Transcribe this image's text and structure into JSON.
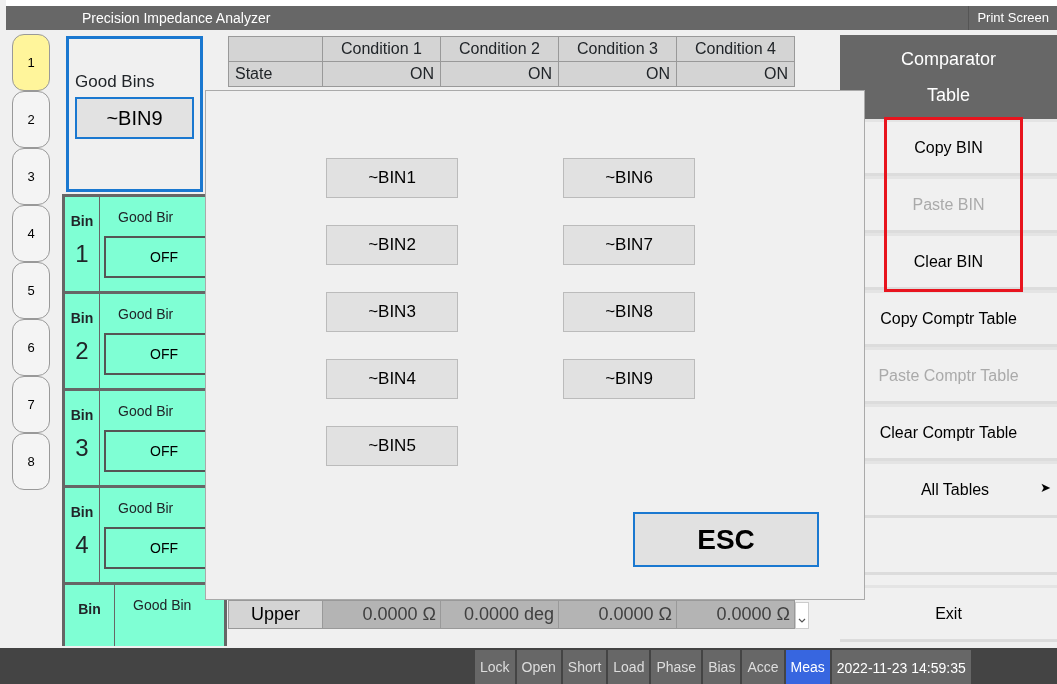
{
  "window": {
    "title": "Precision Impedance Analyzer",
    "print_button": "Print Screen"
  },
  "side_tabs": [
    {
      "label": "1",
      "selected": true
    },
    {
      "label": "2",
      "selected": false
    },
    {
      "label": "3",
      "selected": false
    },
    {
      "label": "4",
      "selected": false
    },
    {
      "label": "5",
      "selected": false
    },
    {
      "label": "6",
      "selected": false
    },
    {
      "label": "7",
      "selected": false
    },
    {
      "label": "8",
      "selected": false
    }
  ],
  "good_bins": {
    "label": "Good Bins",
    "value": "~BIN9"
  },
  "conditions_table": {
    "columns": [
      "Condition 1",
      "Condition 2",
      "Condition 3",
      "Condition 4"
    ],
    "rows": [
      {
        "label": "State",
        "cells": [
          "ON",
          "ON",
          "ON",
          "ON"
        ]
      }
    ]
  },
  "bins": [
    {
      "label": "Bin",
      "number": "1",
      "good_label": "Good Bir",
      "value": "OFF"
    },
    {
      "label": "Bin",
      "number": "2",
      "good_label": "Good Bir",
      "value": "OFF"
    },
    {
      "label": "Bin",
      "number": "3",
      "good_label": "Good Bir",
      "value": "OFF"
    },
    {
      "label": "Bin",
      "number": "4",
      "good_label": "Good Bir",
      "value": "OFF"
    },
    {
      "label": "Bin",
      "good_label": "Good Bin"
    }
  ],
  "limits_table": {
    "rows": [
      {
        "label": "Upper",
        "cells": [
          "0.0000 Ω",
          "0.0000 deg",
          "0.0000 Ω",
          "0.0000 Ω"
        ]
      }
    ]
  },
  "menu": {
    "title_lines": [
      "Comparator",
      "Table"
    ],
    "items": [
      {
        "kind": "action",
        "label": "Copy BIN",
        "disabled": false,
        "highlighted": true
      },
      {
        "kind": "action",
        "label": "Paste BIN",
        "disabled": true,
        "highlighted": true
      },
      {
        "kind": "action",
        "label": "Clear BIN",
        "disabled": false,
        "highlighted": true
      },
      {
        "kind": "action",
        "label": "Copy Comptr Table",
        "disabled": false,
        "highlighted": false
      },
      {
        "kind": "action",
        "label": "Paste Comptr Table",
        "disabled": true,
        "highlighted": false
      },
      {
        "kind": "action",
        "label": "Clear Comptr Table",
        "disabled": false,
        "highlighted": false
      },
      {
        "kind": "submenu",
        "label": "All Tables",
        "arrow": "➤",
        "disabled": false,
        "highlighted": false
      },
      {
        "kind": "spacer",
        "highlighted": false
      },
      {
        "kind": "action",
        "label": "Exit",
        "disabled": false,
        "highlighted": false
      }
    ]
  },
  "dialog": {
    "buttons": [
      {
        "label": "~BIN1"
      },
      {
        "label": "~BIN2"
      },
      {
        "label": "~BIN3"
      },
      {
        "label": "~BIN4"
      },
      {
        "label": "~BIN5"
      },
      {
        "label": "~BIN6"
      },
      {
        "label": "~BIN7"
      },
      {
        "label": "~BIN8"
      },
      {
        "label": "~BIN9"
      }
    ],
    "esc": "ESC"
  },
  "status_bar": {
    "items": [
      {
        "label": "Lock",
        "selected": false
      },
      {
        "label": "Open",
        "selected": false
      },
      {
        "label": "Short",
        "selected": false
      },
      {
        "label": "Load",
        "selected": false
      },
      {
        "label": "Phase",
        "selected": false
      },
      {
        "label": "Bias",
        "selected": false
      },
      {
        "label": "Acce",
        "selected": false
      },
      {
        "label": "Meas",
        "selected": true
      }
    ],
    "datetime": "2022-11-23 14:59:35"
  }
}
